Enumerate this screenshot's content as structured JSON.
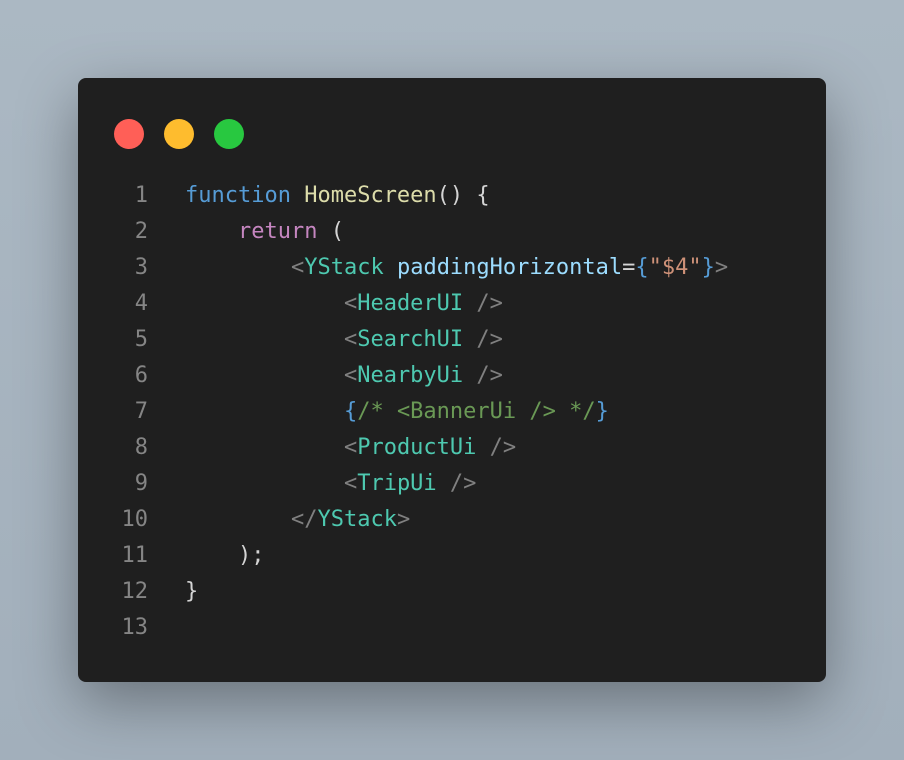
{
  "window": {
    "controls": [
      {
        "name": "close-button",
        "color": "#ff5f57"
      },
      {
        "name": "minimize-button",
        "color": "#febc2e"
      },
      {
        "name": "zoom-button",
        "color": "#28c840"
      }
    ]
  },
  "code": {
    "lines": [
      {
        "num": "1",
        "tokens": [
          [
            "function",
            "kw"
          ],
          [
            " ",
            "plain"
          ],
          [
            "HomeScreen",
            "fn"
          ],
          [
            "()",
            "br"
          ],
          [
            " {",
            "br"
          ]
        ]
      },
      {
        "num": "2",
        "tokens": [
          [
            "    ",
            "plain"
          ],
          [
            "return",
            "ctrl"
          ],
          [
            " (",
            "br"
          ]
        ]
      },
      {
        "num": "3",
        "tokens": [
          [
            "        ",
            "plain"
          ],
          [
            "<",
            "punc"
          ],
          [
            "YStack",
            "tag"
          ],
          [
            " ",
            "plain"
          ],
          [
            "paddingHorizontal",
            "attr"
          ],
          [
            "=",
            "plain"
          ],
          [
            "{",
            "blue"
          ],
          [
            "\"$4\"",
            "str"
          ],
          [
            "}",
            "blue"
          ],
          [
            ">",
            "punc"
          ]
        ]
      },
      {
        "num": "4",
        "tokens": [
          [
            "            ",
            "plain"
          ],
          [
            "<",
            "punc"
          ],
          [
            "HeaderUI",
            "tag"
          ],
          [
            " />",
            "punc"
          ]
        ]
      },
      {
        "num": "5",
        "tokens": [
          [
            "            ",
            "plain"
          ],
          [
            "<",
            "punc"
          ],
          [
            "SearchUI",
            "tag"
          ],
          [
            " />",
            "punc"
          ]
        ]
      },
      {
        "num": "6",
        "tokens": [
          [
            "            ",
            "plain"
          ],
          [
            "<",
            "punc"
          ],
          [
            "NearbyUi",
            "tag"
          ],
          [
            " />",
            "punc"
          ]
        ]
      },
      {
        "num": "7",
        "tokens": [
          [
            "            ",
            "plain"
          ],
          [
            "{",
            "blue"
          ],
          [
            "/* <BannerUi /> */",
            "com"
          ],
          [
            "}",
            "blue"
          ]
        ]
      },
      {
        "num": "8",
        "tokens": [
          [
            "            ",
            "plain"
          ],
          [
            "<",
            "punc"
          ],
          [
            "ProductUi",
            "tag"
          ],
          [
            " />",
            "punc"
          ]
        ]
      },
      {
        "num": "9",
        "tokens": [
          [
            "            ",
            "plain"
          ],
          [
            "<",
            "punc"
          ],
          [
            "TripUi",
            "tag"
          ],
          [
            " />",
            "punc"
          ]
        ]
      },
      {
        "num": "10",
        "tokens": [
          [
            "        ",
            "plain"
          ],
          [
            "</",
            "punc"
          ],
          [
            "YStack",
            "tag"
          ],
          [
            ">",
            "punc"
          ]
        ]
      },
      {
        "num": "11",
        "tokens": [
          [
            "    ",
            "plain"
          ],
          [
            ");",
            "br"
          ]
        ]
      },
      {
        "num": "12",
        "tokens": [
          [
            "}",
            "br"
          ]
        ]
      },
      {
        "num": "13",
        "tokens": []
      }
    ]
  }
}
